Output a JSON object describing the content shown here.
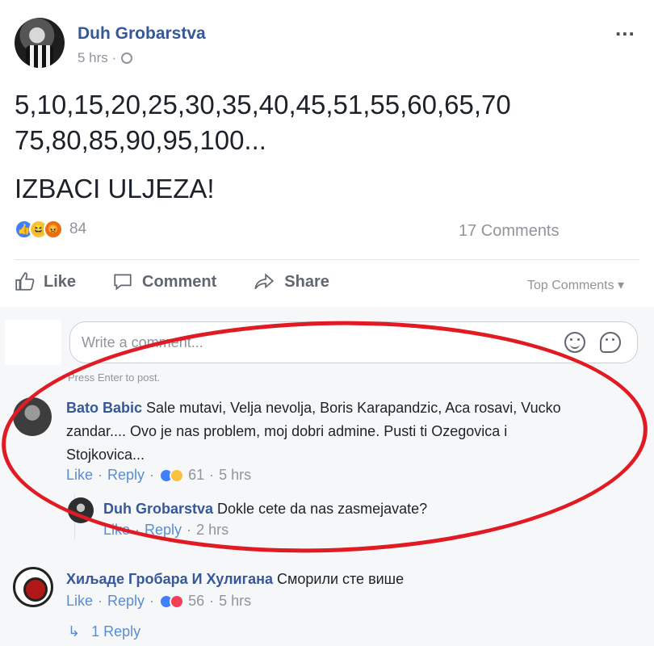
{
  "post": {
    "author": "Duh Grobarstva",
    "time": "5 hrs ·",
    "more": "...",
    "text_line1": "5,10,15,20,25,30,35,40,45,51,55,60,65,70",
    "text_line2": "75,80,85,90,95,100...",
    "text_line3": "IZBACI ULJEZA!",
    "reaction_count": "84",
    "comments_count": "17 Comments"
  },
  "actions": {
    "like": "Like",
    "comment": "Comment",
    "share": "Share",
    "top_comments": "Top Comments ▾"
  },
  "composer": {
    "placeholder": "Write a comment...",
    "hint": "Press Enter to post."
  },
  "comments": [
    {
      "author": "Bato Babic",
      "text": "Sale mutavi, Velja nevolja, Boris Karapandzic, Aca rosavi, Vucko zandar.... Ovo je nas problem, moj dobri admine. Pusti ti Ozegovica i Stojkovica...",
      "like": "Like",
      "reply": "Reply",
      "reactions": "61",
      "time": "5 hrs"
    },
    {
      "author": "Duh Grobarstva",
      "text": "Dokle cete da nas zasmejavate?",
      "like": "Like",
      "reply": "Reply",
      "time": "2 hrs"
    },
    {
      "author": "Хиљаде Гробара И Хулигана",
      "text": "Сморили сте више",
      "like": "Like",
      "reply": "Reply",
      "reactions": "56",
      "time": "5 hrs"
    }
  ],
  "replies_link": "1 Reply",
  "colors": {
    "link": "#365899",
    "action_link": "#598dd1",
    "muted": "#90949c",
    "highlight": "#e01b24"
  }
}
